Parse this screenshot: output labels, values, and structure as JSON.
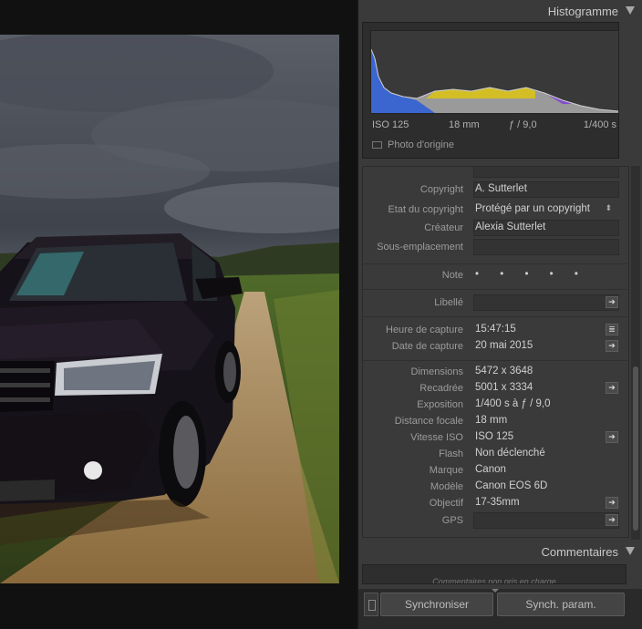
{
  "histogram": {
    "title": "Histogramme",
    "iso": "ISO 125",
    "focal": "18 mm",
    "aperture": "ƒ / 9,0",
    "shutter": "1/400 s",
    "original_photo_label": "Photo d'origine"
  },
  "metadata": {
    "copyright_label": "Copyright",
    "copyright_value": "A. Sutterlet",
    "copyright_status_label": "Etat du copyright",
    "copyright_status_value": "Protégé par un copyright",
    "creator_label": "Créateur",
    "creator_value": "Alexia Sutterlet",
    "sublocation_label": "Sous-emplacement",
    "sublocation_value": "",
    "rating_label": "Note",
    "rating_stars": "• • • • •",
    "label_label": "Libellé",
    "label_value": "",
    "capture_time_label": "Heure de capture",
    "capture_time_value": "15:47:15",
    "capture_date_label": "Date de capture",
    "capture_date_value": "20 mai 2015",
    "dimensions_label": "Dimensions",
    "dimensions_value": "5472 x 3648",
    "cropped_label": "Recadrée",
    "cropped_value": "5001 x 3334",
    "exposure_label": "Exposition",
    "exposure_value": "1/400 s à ƒ / 9,0",
    "focal_label": "Distance focale",
    "focal_value": "18 mm",
    "iso_label": "Vitesse ISO",
    "iso_value": "ISO 125",
    "flash_label": "Flash",
    "flash_value": "Non déclenché",
    "make_label": "Marque",
    "make_value": "Canon",
    "model_label": "Modèle",
    "model_value": "Canon EOS 6D",
    "lens_label": "Objectif",
    "lens_value": "17-35mm",
    "gps_label": "GPS",
    "gps_value": ""
  },
  "comments": {
    "title": "Commentaires",
    "placeholder": "Commentaires non pris en charge"
  },
  "bottom": {
    "sync_label": "Synchroniser",
    "sync_params_label": "Synch. param."
  },
  "colors": {
    "panel_bg": "#3a3a3a",
    "accent_yellow": "#d9c21a",
    "accent_blue": "#2a5cd8"
  }
}
